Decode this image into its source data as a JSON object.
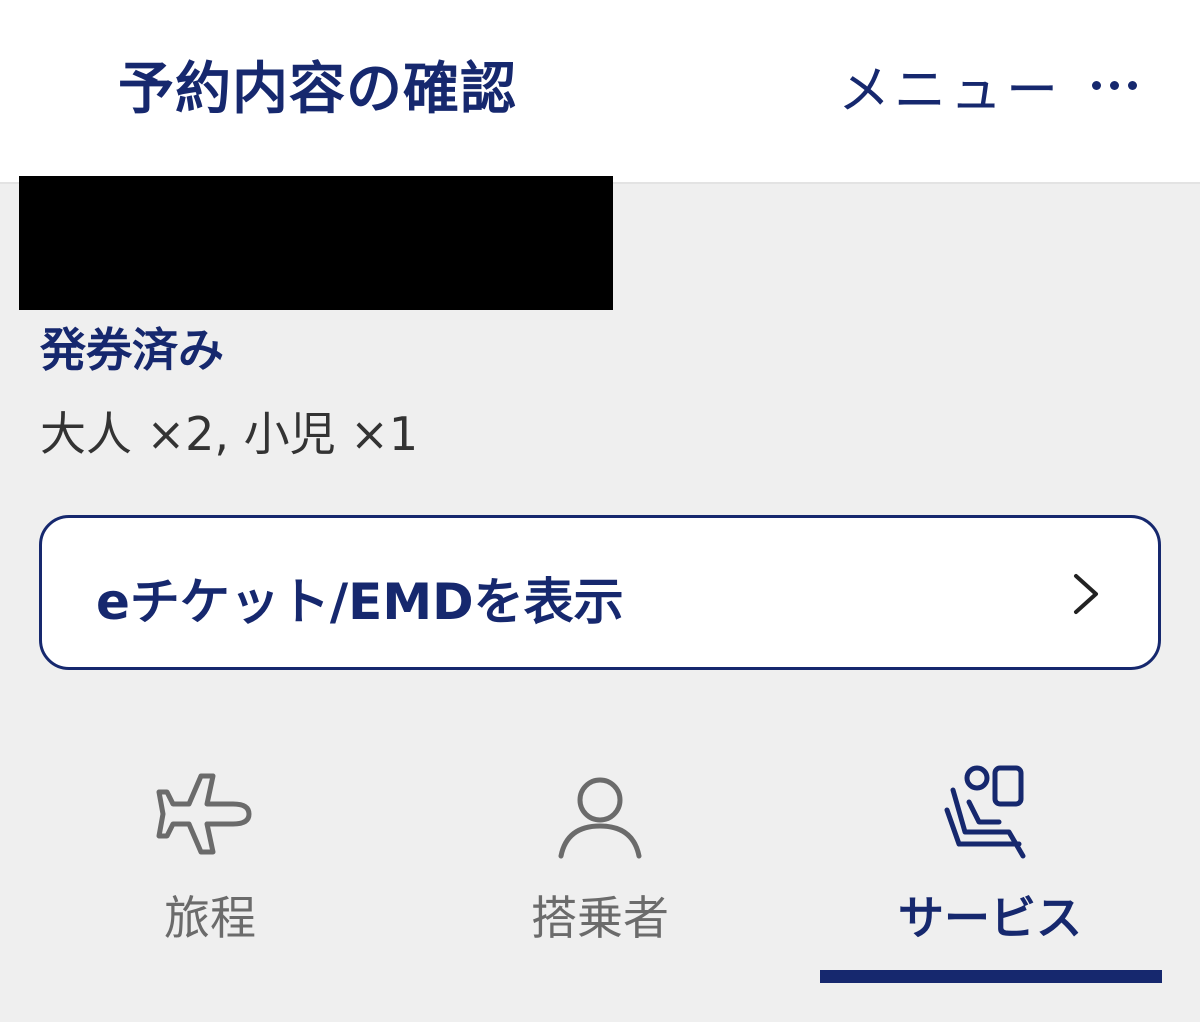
{
  "header": {
    "title": "予約内容の確認",
    "menu_label": "メニュー",
    "more_icon": "more-dots-icon"
  },
  "booking": {
    "status": "発券済み",
    "passengers": "大人 ×2, 小児 ×1"
  },
  "eticket_button": {
    "label": "eチケット/EMDを表示",
    "icon": "chevron-right-icon"
  },
  "tabs": [
    {
      "label": "旅程",
      "icon": "airplane-icon",
      "active": false
    },
    {
      "label": "搭乗者",
      "icon": "person-icon",
      "active": false
    },
    {
      "label": "サービス",
      "icon": "seat-icon",
      "active": true
    }
  ],
  "colors": {
    "brand_navy": "#16286e",
    "background": "#efefef",
    "inactive_gray": "#6b6b6b",
    "text_dark": "#333333"
  }
}
